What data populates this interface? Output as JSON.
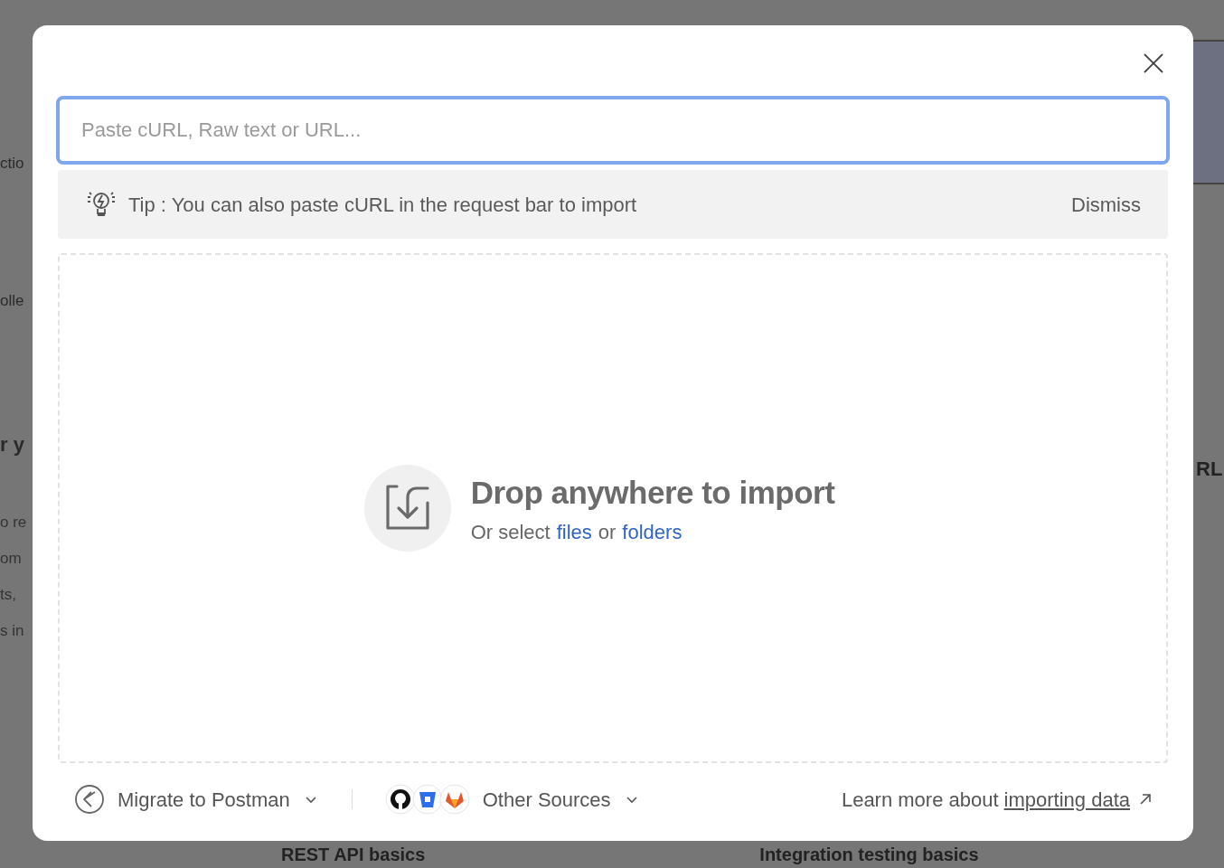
{
  "background": {
    "left_texts": [
      "ctio",
      "olle",
      "r y",
      "o re",
      "om",
      "ts,",
      "s in"
    ],
    "right_texts": [
      "RL"
    ],
    "bottom_cards": [
      "REST API basics",
      "Integration testing basics"
    ]
  },
  "dialog": {
    "input": {
      "placeholder": "Paste cURL, Raw text or URL..."
    },
    "tip": {
      "text": "Tip : You can also paste cURL in the request bar to import",
      "dismiss": "Dismiss"
    },
    "dropzone": {
      "title": "Drop anywhere to import",
      "prefix": "Or select",
      "link1": "files",
      "middle": "or",
      "link2": "folders"
    },
    "footer": {
      "migrate": "Migrate to Postman",
      "other_sources": "Other Sources",
      "learn_prefix": "Learn more about",
      "learn_link": "importing data"
    }
  }
}
